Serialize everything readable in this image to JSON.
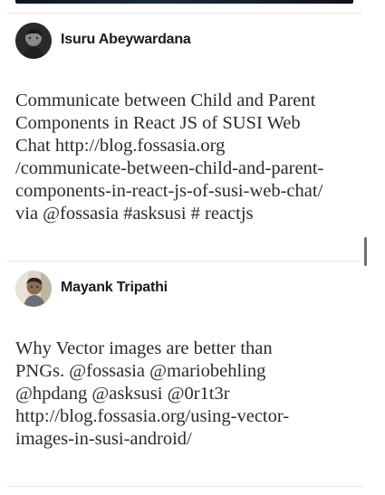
{
  "feed": {
    "posts": [
      {
        "author": "Isuru Abeywardana",
        "avatar": "avatar-photo",
        "text": "Communicate between Child and Parent\nComponents in React JS of SUSI Web\nChat http://blog.fossasia.org\n/communicate-between-child-and-parent-\ncomponents-in-react-js-of-susi-web-chat/\nvia @fossasia #asksusi # reactjs"
      },
      {
        "author": "Mayank Tripathi",
        "avatar": "avatar-photo",
        "text": "Why Vector images are better than\nPNGs. @fossasia @mariobehling\n@hpdang @asksusi @0r1t3r\nhttp://blog.fossasia.org/using-vector-\nimages-in-susi-android/"
      }
    ]
  }
}
